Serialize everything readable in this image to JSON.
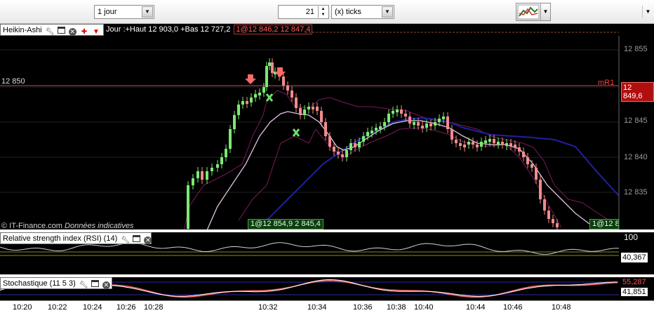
{
  "toolbar": {
    "period": "1 jour",
    "ticks_value": "21",
    "ticks_unit": "(x) ticks"
  },
  "main_panel": {
    "title": "Heikin-Ashi",
    "info": "Jour :+Haut 12 903,0 +Bas 12 727,2",
    "info_tag": "1@12 846,2 12 847,4",
    "level_left_label": "12 850",
    "level_right_label": "mR1",
    "current_price_tag": "12 849,6",
    "credit": "© IT-Finance.com",
    "credit_note": "Données indicatives",
    "bottom_tag": "1@12 854,9 2 845,4",
    "bottom_right_tag": "1@12 8",
    "y_ticks": [
      "12 855",
      "12 850",
      "12 845",
      "12 840",
      "12 835"
    ]
  },
  "rsi_panel": {
    "title": "Relative strength index (RSI) (14)",
    "scale_top": "100",
    "value": "40,367"
  },
  "stoch_panel": {
    "title": "Stochastique (11 5 3)",
    "value_top": "55,287",
    "value_bottom": "41,851"
  },
  "time_axis": [
    "10:20",
    "10:22",
    "10:24",
    "10:26",
    "10:28",
    "10:32",
    "10:34",
    "10:36",
    "10:38",
    "10:40",
    "10:44",
    "10:46",
    "10:48"
  ],
  "colors": {
    "up_candle": "#7bea6f",
    "down_candle": "#f28b8b",
    "ma_slow": "#2a2a9c",
    "ma_fast": "#e6c6e6",
    "envelope": "#7a1a5a",
    "level_line": "#c84848"
  }
}
